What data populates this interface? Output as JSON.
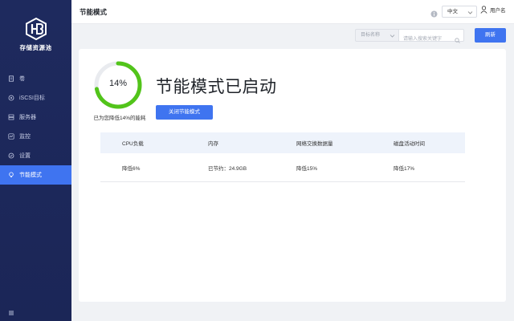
{
  "brand": {
    "name": "存储资源池"
  },
  "sidebar": {
    "items": [
      {
        "label": "卷",
        "icon": "document-icon"
      },
      {
        "label": "iSCSI目标",
        "icon": "target-icon"
      },
      {
        "label": "服务器",
        "icon": "server-icon"
      },
      {
        "label": "监控",
        "icon": "monitor-icon"
      },
      {
        "label": "设置",
        "icon": "settings-icon"
      },
      {
        "label": "节能模式",
        "icon": "bulb-icon",
        "active": true
      }
    ],
    "toggle_icon": "menu-icon"
  },
  "header": {
    "title": "节能模式",
    "language": "中文",
    "username": "用户名"
  },
  "toolbar": {
    "filter_label": "目标名称",
    "search_placeholder": "请输入搜索关键字",
    "refresh_label": "刷新"
  },
  "status": {
    "percent": 14,
    "percent_label": "14%",
    "caption": "已为您降低14%的能耗",
    "headline": "节能模式已启动",
    "disable_label": "关闭节能模式",
    "accent_color": "#3f74f0",
    "gauge_color": "#52c41a"
  },
  "table": {
    "headers": [
      "CPU负载",
      "内存",
      "网络交换数据量",
      "磁盘活动时间"
    ],
    "row": [
      "降低6%",
      "已节约：24.9GB",
      "降低15%",
      "降低17%"
    ]
  }
}
